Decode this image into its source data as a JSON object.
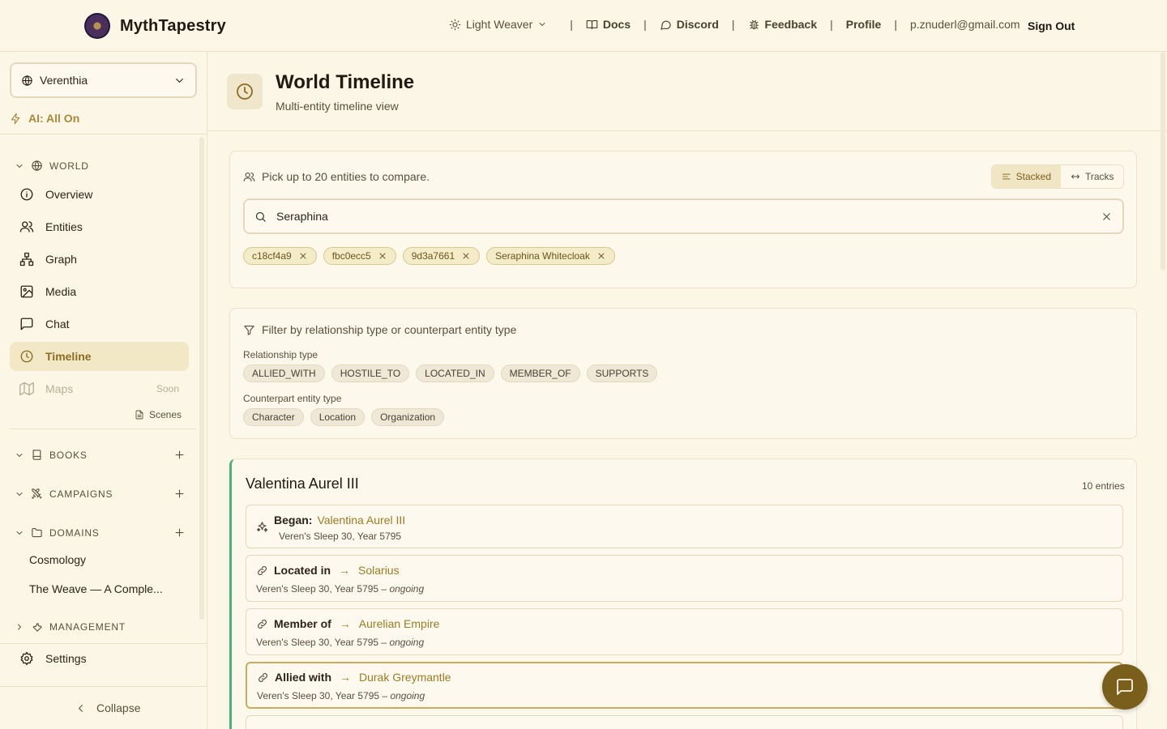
{
  "brand": {
    "name": "MythTapestry"
  },
  "topnav": {
    "theme": "Light Weaver",
    "docs": "Docs",
    "discord": "Discord",
    "feedback": "Feedback",
    "profile": "Profile",
    "email": "p.znuderl@gmail.com",
    "signout": "Sign Out",
    "separator": "|"
  },
  "sidebar": {
    "world": "Verenthia",
    "ai": "AI: All On",
    "world_section": "WORLD",
    "items": [
      {
        "label": "Overview"
      },
      {
        "label": "Entities"
      },
      {
        "label": "Graph"
      },
      {
        "label": "Media"
      },
      {
        "label": "Chat"
      },
      {
        "label": "Timeline"
      },
      {
        "label": "Maps",
        "badge": "Soon"
      }
    ],
    "scenes": "Scenes",
    "books": "BOOKS",
    "campaigns": "CAMPAIGNS",
    "domains": "DOMAINS",
    "domain_items": [
      "Cosmology",
      "The Weave — A Comple..."
    ],
    "management": "MANAGEMENT",
    "settings": "Settings",
    "collapse": "Collapse"
  },
  "header": {
    "title": "World Timeline",
    "subtitle": "Multi-entity timeline view"
  },
  "picker": {
    "label": "Pick up to 20 entities to compare.",
    "view_stacked": "Stacked",
    "view_tracks": "Tracks",
    "search_value": "Seraphina",
    "chips": [
      "c18cf4a9",
      "fbc0ecc5",
      "9d3a7661",
      "Seraphina Whitecloak"
    ]
  },
  "filters": {
    "title": "Filter by relationship type or counterpart entity type",
    "rel_label": "Relationship type",
    "rel_types": [
      "ALLIED_WITH",
      "HOSTILE_TO",
      "LOCATED_IN",
      "MEMBER_OF",
      "SUPPORTS"
    ],
    "cp_label": "Counterpart entity type",
    "cp_types": [
      "Character",
      "Location",
      "Organization"
    ]
  },
  "timeline": {
    "entity": "Valentina Aurel III",
    "count": "10 entries",
    "arrow": "→",
    "entries": [
      {
        "kind": "Began:",
        "target": "Valentina Aurel III",
        "date": "Veren's Sleep 30, Year 5795",
        "status": ""
      },
      {
        "kind": "Located in",
        "target": "Solarius",
        "date": "Veren's Sleep 30, Year 5795 –",
        "status": "ongoing"
      },
      {
        "kind": "Member of",
        "target": "Aurelian Empire",
        "date": "Veren's Sleep 30, Year 5795 –",
        "status": "ongoing"
      },
      {
        "kind": "Allied with",
        "target": "Durak Greymantle",
        "date": "Veren's Sleep 30, Year 5795 –",
        "status": "ongoing"
      }
    ]
  },
  "colors": {
    "accent": "#8a6d22",
    "track": "#49b27c",
    "fab": "#7a5f1c"
  }
}
